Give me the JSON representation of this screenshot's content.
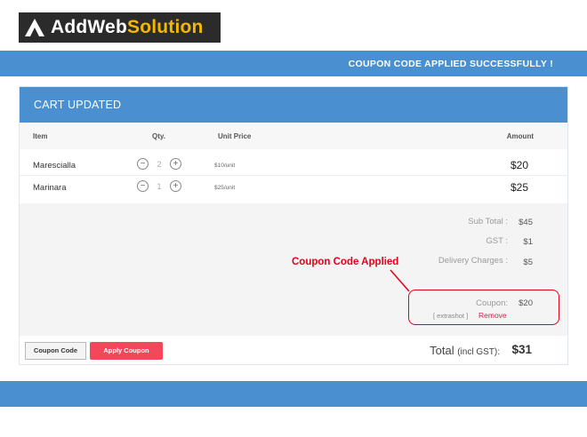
{
  "brand": {
    "name_part1": "AddWeb",
    "name_part2": "Solution",
    "accent_color": "#f5b800"
  },
  "banner": {
    "message": "COUPON CODE APPLIED SUCCESSFULLY !",
    "color": "#4a8fd0"
  },
  "cart": {
    "title": "CART UPDATED",
    "columns": {
      "item": "Item",
      "qty": "Qty.",
      "unit_price": "Unit Price",
      "amount": "Amount"
    },
    "items": [
      {
        "name": "Marescialla",
        "qty": "2",
        "unit_price": "$10/unit",
        "amount": "$20"
      },
      {
        "name": "Marinara",
        "qty": "1",
        "unit_price": "$25/unit",
        "amount": "$25"
      }
    ],
    "summary": {
      "subtotal_label": "Sub Total :",
      "subtotal_value": "$45",
      "gst_label": "GST :",
      "gst_value": "$1",
      "delivery_label": "Delivery Charges :",
      "delivery_value": "$5"
    },
    "coupon": {
      "annotation": "Coupon Code Applied",
      "label": "Coupon:",
      "value": "$20",
      "code": "[ extrashot ]",
      "remove_label": "Remove"
    },
    "footer": {
      "coupon_code_button": "Coupon Code",
      "apply_coupon_button": "Apply Coupon",
      "total_label": "Total",
      "total_suffix": "(incl GST):",
      "total_value": "$31"
    }
  }
}
